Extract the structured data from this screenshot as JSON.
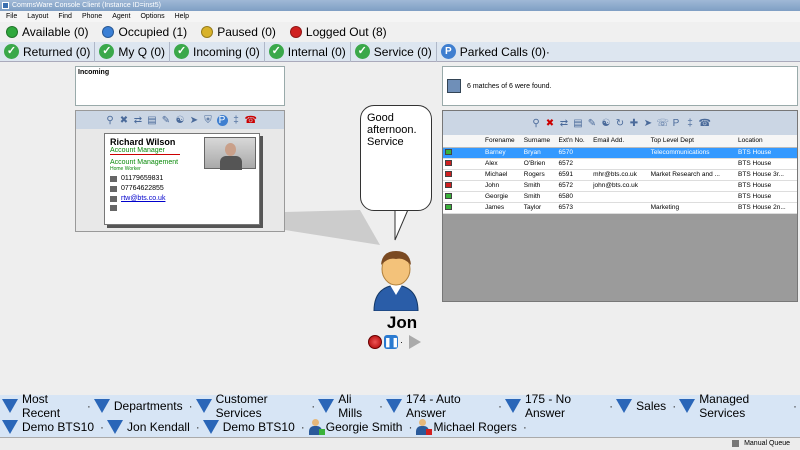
{
  "window": {
    "title": "CommsWare Console Client (Instance ID=inst5)"
  },
  "menu": [
    "File",
    "Layout",
    "Find",
    "Phone",
    "Agent",
    "Options",
    "Help"
  ],
  "statuses": [
    {
      "label": "Available (0)",
      "color": "#2fa83c"
    },
    {
      "label": "Occupied (1)",
      "color": "#3a7fd5"
    },
    {
      "label": "Paused (0)",
      "color": "#d8b22a"
    },
    {
      "label": "Logged Out (8)",
      "color": "#d02020"
    }
  ],
  "tabs": [
    "Returned (0)",
    "My Q (0)",
    "Incoming (0)",
    "Internal (0)",
    "Service (0)"
  ],
  "parked": {
    "label": "Parked Calls (0)",
    "badge": "P"
  },
  "incoming": {
    "label": "Incoming"
  },
  "contact": {
    "name": "Richard Wilson",
    "role": "Account Manager",
    "dept": "Account Management",
    "location": "Home Worker",
    "phone1": "01179659831",
    "phone2": "07764622855",
    "email": "rtw@bts.co.uk"
  },
  "bubble": {
    "text": "Good afternoon. Service"
  },
  "agent": {
    "name": "Jon"
  },
  "directory": {
    "matches": "6 matches of 6 were found.",
    "columns": [
      "",
      "Forename",
      "Surname",
      "Ext'n No.",
      "Email Add.",
      "Top Level Dept",
      "Location"
    ],
    "rows": [
      {
        "status": "#3ab23a",
        "forename": "Barney",
        "surname": "Bryan",
        "ext": "6570",
        "email": "",
        "dept": "Telecommunications",
        "location": "BTS House",
        "selected": true
      },
      {
        "status": "#d02020",
        "forename": "Alex",
        "surname": "O'Brien",
        "ext": "6572",
        "email": "",
        "dept": "",
        "location": "BTS House"
      },
      {
        "status": "#d02020",
        "forename": "Michael",
        "surname": "Rogers",
        "ext": "6591",
        "email": "mhr@bts.co.uk",
        "dept": "Market Research and ...",
        "location": "BTS House 3r..."
      },
      {
        "status": "#d02020",
        "forename": "John",
        "surname": "Smith",
        "ext": "6572",
        "email": "john@bts.co.uk",
        "dept": "",
        "location": "BTS House"
      },
      {
        "status": "#3ab23a",
        "forename": "Georgie",
        "surname": "Smith",
        "ext": "6580",
        "email": "",
        "dept": "",
        "location": "BTS House"
      },
      {
        "status": "#3ab23a",
        "forename": "James",
        "surname": "Taylor",
        "ext": "6573",
        "email": "",
        "dept": "Marketing",
        "location": "BTS House 2n..."
      }
    ]
  },
  "shortcuts_row1": [
    "Most Recent",
    "Departments",
    "Customer Services",
    "Ali Mills",
    "174 - Auto Answer",
    "175 - No Answer",
    "Sales",
    "Managed Services"
  ],
  "shortcuts_row2": [
    {
      "label": "Demo BTS10",
      "type": "group"
    },
    {
      "label": "Jon Kendall",
      "type": "group"
    },
    {
      "label": "Demo BTS10",
      "type": "group"
    },
    {
      "label": "Georgie Smith",
      "type": "person",
      "status": "#3ab23a"
    },
    {
      "label": "Michael Rogers",
      "type": "person",
      "status": "#d02020"
    }
  ],
  "bottom": {
    "label": "Manual Queue"
  }
}
